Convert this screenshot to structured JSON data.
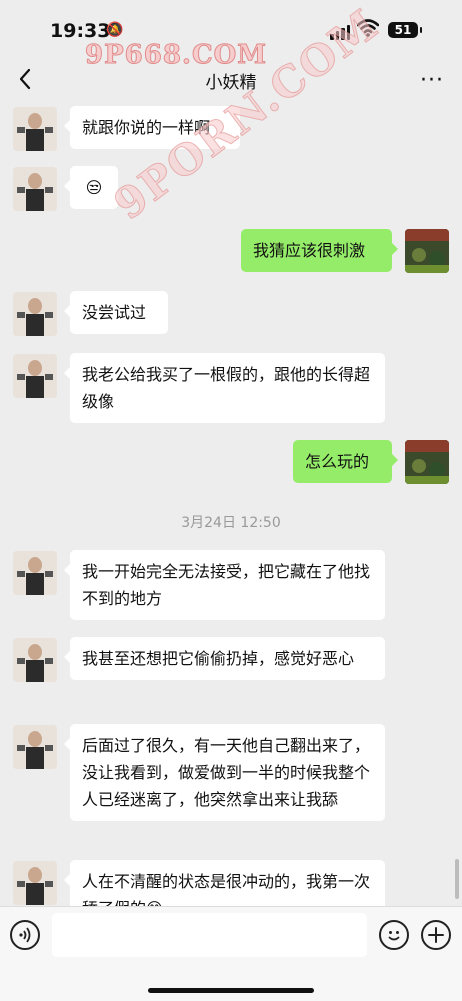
{
  "status_bar": {
    "time": "19:33",
    "battery": "51"
  },
  "watermark": {
    "top": "9P668.COM",
    "diagonal": "9PORN.COM"
  },
  "header": {
    "title": "小妖精",
    "more": "···"
  },
  "messages": [
    {
      "side": "left",
      "text": "就跟你说的一样啊"
    },
    {
      "side": "left",
      "text": "😒"
    },
    {
      "side": "right",
      "text": "我猜应该很刺激"
    },
    {
      "side": "left",
      "text": "没尝试过"
    },
    {
      "side": "left",
      "text": "我老公给我买了一根假的，跟他的长得超级像"
    },
    {
      "side": "right",
      "text": "怎么玩的"
    },
    {
      "side": "left",
      "text": "我一开始完全无法接受，把它藏在了他找不到的地方"
    },
    {
      "side": "left",
      "text": "我甚至还想把它偷偷扔掉，感觉好恶心"
    },
    {
      "side": "left",
      "text": "后面过了很久，有一天他自己翻出来了，没让我看到，做爱做到一半的时候我整个人已经迷离了，他突然拿出来让我舔"
    },
    {
      "side": "left",
      "text": "人在不清醒的状态是很冲动的，我第一次舔了假的😊"
    }
  ],
  "timestamp": "3月24日 12:50",
  "colors": {
    "background": "#ededed",
    "bubble_self": "#95ec69",
    "bubble_other": "#ffffff"
  },
  "icons": {
    "voice": "voice-icon",
    "emoji": "emoji-icon",
    "plus": "plus-icon",
    "back": "back-icon"
  }
}
